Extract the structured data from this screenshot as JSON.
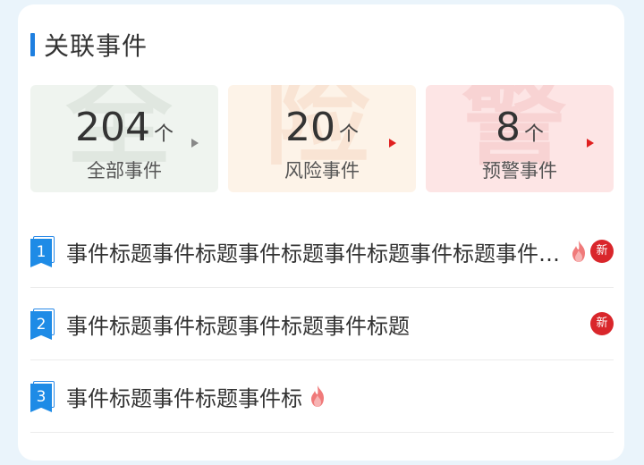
{
  "section": {
    "title": "关联事件"
  },
  "stats": [
    {
      "value": "204",
      "unit": "个",
      "label": "全部事件",
      "watermark": "全",
      "arrow_color": "#888888"
    },
    {
      "value": "20",
      "unit": "个",
      "label": "风险事件",
      "watermark": "险",
      "arrow_color": "#e02020"
    },
    {
      "value": "8",
      "unit": "个",
      "label": "预警事件",
      "watermark": "警",
      "arrow_color": "#e02020"
    }
  ],
  "events": [
    {
      "rank": "1",
      "title": "事件标题事件标题事件标题事件标题事件标题事件标题",
      "hot_icon": "fire-icon",
      "new_label": "新"
    },
    {
      "rank": "2",
      "title": "事件标题事件标题事件标题事件标题",
      "new_label": "新"
    },
    {
      "rank": "3",
      "title": "事件标题事件标题事件标",
      "hot_icon": "fire-icon"
    }
  ],
  "colors": {
    "accent": "#1e7fe0",
    "badge_red": "#d9262b",
    "stat_all_bg": "#eff4ef",
    "stat_risk_bg": "#fdf3e8",
    "stat_warn_bg": "#fde5e5"
  }
}
